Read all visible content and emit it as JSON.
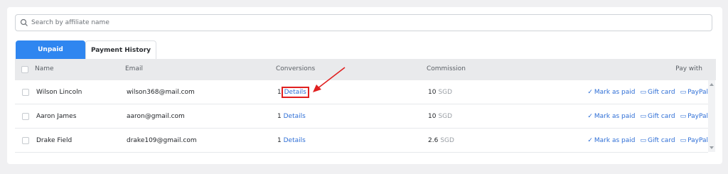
{
  "search": {
    "placeholder": "Search by affiliate name",
    "value": ""
  },
  "tabs": [
    {
      "label": "Unpaid",
      "active": true
    },
    {
      "label": "Payment History",
      "active": false
    }
  ],
  "table": {
    "columns": [
      "Name",
      "Email",
      "Conversions",
      "Commission",
      "Pay with"
    ],
    "rows": [
      {
        "name": "Wilson Lincoln",
        "email": "wilson368@mail.com",
        "conversions": "1",
        "details": "Details",
        "commission": "10",
        "currency": "SGD"
      },
      {
        "name": "Aaron James",
        "email": "aaron@gmail.com",
        "conversions": "1",
        "details": "Details",
        "commission": "10",
        "currency": "SGD"
      },
      {
        "name": "Drake Field",
        "email": "drake109@gmail.com",
        "conversions": "1",
        "details": "Details",
        "commission": "2.6",
        "currency": "SGD"
      }
    ],
    "actions": {
      "mark_paid": "Mark as paid",
      "gift_card": "Gift card",
      "paypal": "PayPal"
    }
  },
  "colors": {
    "accent": "#2f86f0",
    "link": "#2f6fd6",
    "highlight": "#e02020"
  }
}
